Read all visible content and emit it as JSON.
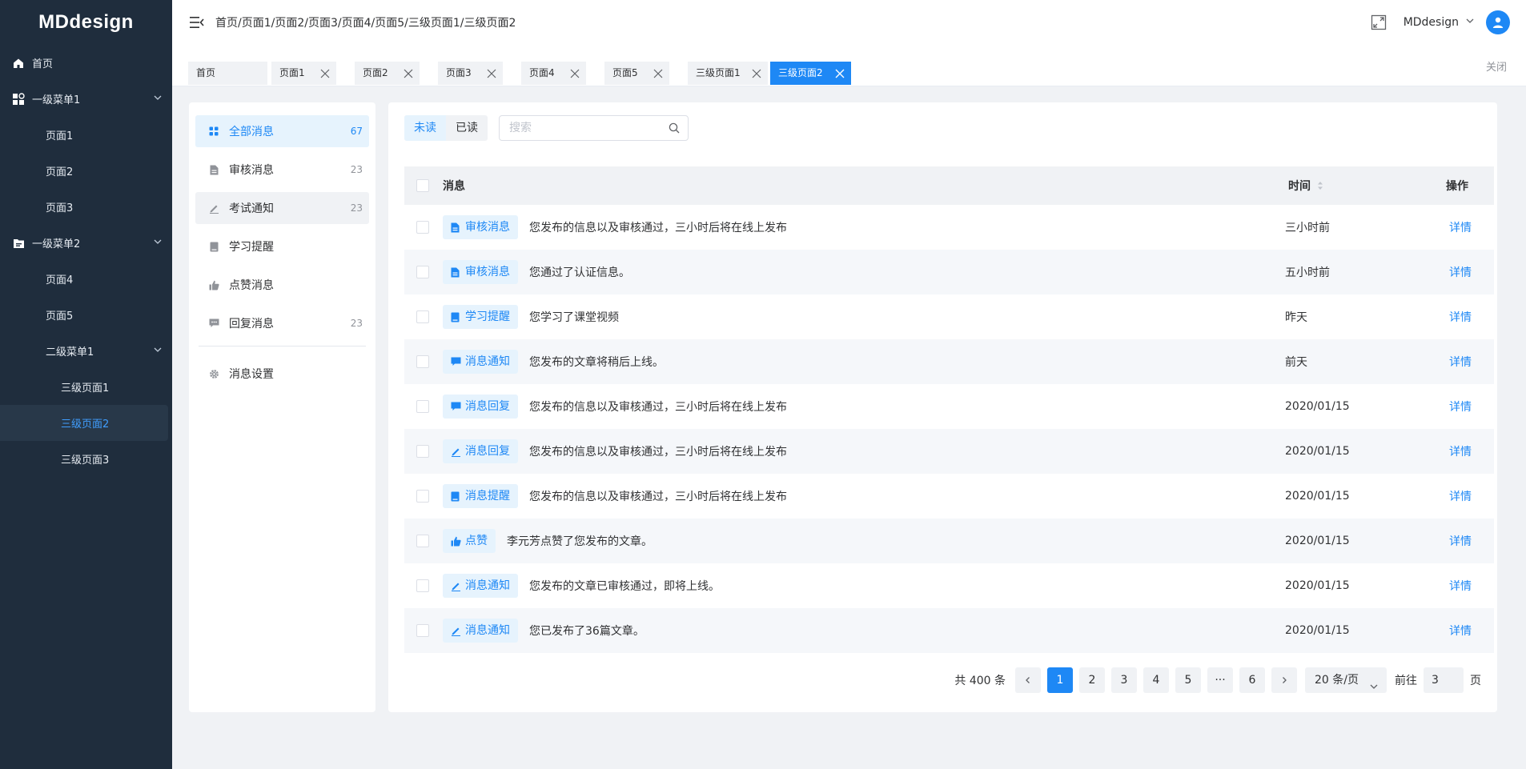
{
  "app": {
    "logo": "MDdesign"
  },
  "sidebar": {
    "items": [
      {
        "label": "首页"
      },
      {
        "label": "一级菜单1"
      },
      {
        "label": "页面1"
      },
      {
        "label": "页面2"
      },
      {
        "label": "页面3"
      },
      {
        "label": "一级菜单2"
      },
      {
        "label": "页面4"
      },
      {
        "label": "页面5"
      },
      {
        "label": "二级菜单1"
      },
      {
        "label": "三级页面1"
      },
      {
        "label": "三级页面2"
      },
      {
        "label": "三级页面3"
      }
    ],
    "active": "三级页面2"
  },
  "header": {
    "breadcrumb": [
      "首页/",
      "页面1/",
      "页面2/",
      "页面3/",
      "页面4/",
      "页面5/",
      "三级页面1/",
      "三级页面2"
    ],
    "user_name": "MDdesign"
  },
  "tags": {
    "items": [
      {
        "label": "首页"
      },
      {
        "label": "页面1"
      },
      {
        "label": "页面2"
      },
      {
        "label": "页面3"
      },
      {
        "label": "页面4"
      },
      {
        "label": "页面5"
      },
      {
        "label": "三级页面1"
      },
      {
        "label": "三级页面2"
      }
    ],
    "close_all": "关闭"
  },
  "categories": {
    "items": [
      {
        "label": "全部消息",
        "count": "67"
      },
      {
        "label": "审核消息",
        "count": "23"
      },
      {
        "label": "考试通知",
        "count": "23"
      },
      {
        "label": "学习提醒",
        "count": ""
      },
      {
        "label": "点赞消息",
        "count": ""
      },
      {
        "label": "回复消息",
        "count": "23"
      }
    ],
    "settings": "消息设置"
  },
  "filter": {
    "unread": "未读",
    "read": "已读",
    "search_placeholder": "搜索"
  },
  "table": {
    "headers": {
      "message": "消息",
      "time": "时间",
      "action": "操作"
    },
    "rows": [
      {
        "tag": "审核消息",
        "icon": "document-icon",
        "text": "您发布的信息以及审核通过，三小时后将在线上发布",
        "time": "三小时前",
        "action": "详情"
      },
      {
        "tag": "审核消息",
        "icon": "document-icon",
        "text": "您通过了认证信息。",
        "time": "五小时前",
        "action": "详情"
      },
      {
        "tag": "学习提醒",
        "icon": "book-icon",
        "text": "您学习了课堂视频",
        "time": "昨天",
        "action": "详情"
      },
      {
        "tag": "消息通知",
        "icon": "chat-icon",
        "text": "您发布的文章将稍后上线。",
        "time": "前天",
        "action": "详情"
      },
      {
        "tag": "消息回复",
        "icon": "chat-icon",
        "text": "您发布的信息以及审核通过，三小时后将在线上发布",
        "time": "2020/01/15",
        "action": "详情"
      },
      {
        "tag": "消息回复",
        "icon": "pen-icon",
        "text": "您发布的信息以及审核通过，三小时后将在线上发布",
        "time": "2020/01/15",
        "action": "详情"
      },
      {
        "tag": "消息提醒",
        "icon": "book-icon",
        "text": "您发布的信息以及审核通过，三小时后将在线上发布",
        "time": "2020/01/15",
        "action": "详情"
      },
      {
        "tag": "点赞",
        "icon": "thumb-up-icon",
        "text": "李元芳点赞了您发布的文章。",
        "time": "2020/01/15",
        "action": "详情"
      },
      {
        "tag": "消息通知",
        "icon": "pen-icon",
        "text": "您发布的文章已审核通过，即将上线。",
        "time": "2020/01/15",
        "action": "详情"
      },
      {
        "tag": "消息通知",
        "icon": "pen-icon",
        "text": "您已发布了36篇文章。",
        "time": "2020/01/15",
        "action": "详情"
      }
    ]
  },
  "pagination": {
    "total": "共 400 条",
    "pages": [
      "1",
      "2",
      "3",
      "4",
      "5",
      "···",
      "6"
    ],
    "current": "1",
    "page_size": "20 条/页",
    "goto_label": "前往",
    "goto_value": "3",
    "page_suffix": "页"
  },
  "colors": {
    "primary": "#1e88f5",
    "sidebar_bg": "#1f2d3d",
    "active_menu_text": "#409eff",
    "badge_bg": "#e6f3fd"
  }
}
